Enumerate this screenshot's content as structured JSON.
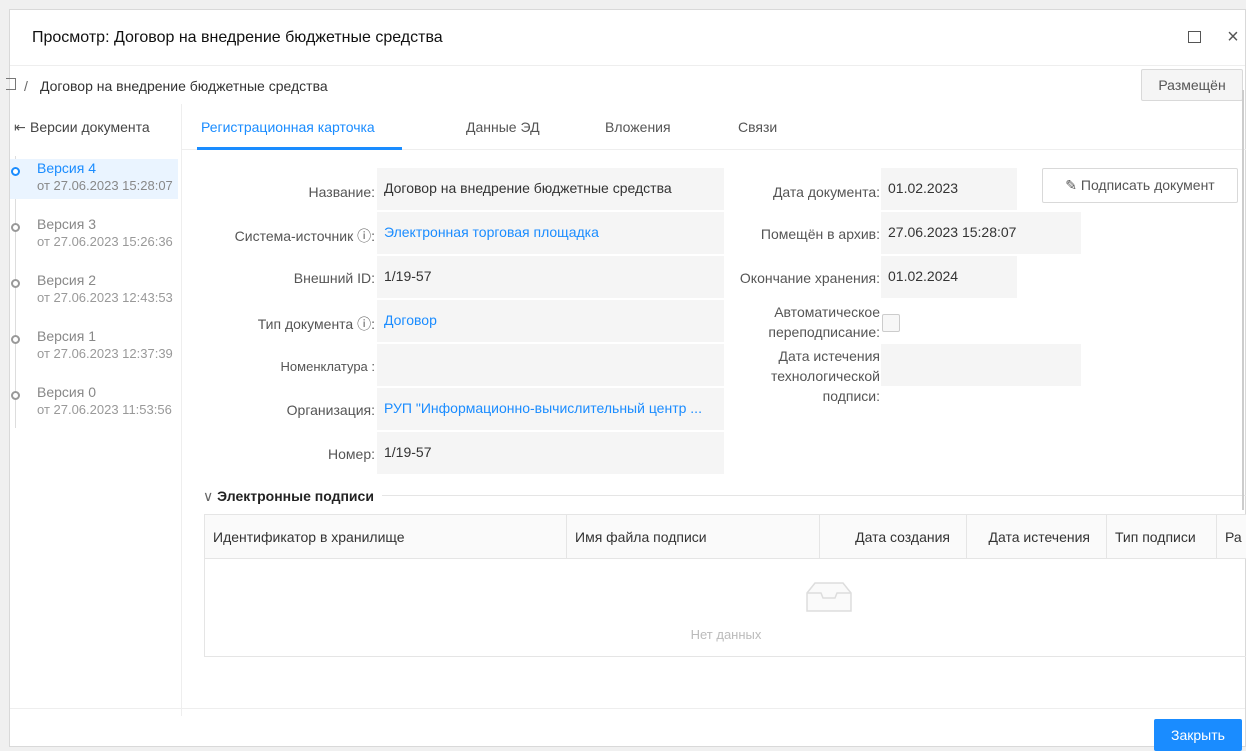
{
  "window": {
    "title": "Просмотр: Договор на внедрение бюджетные средства",
    "maximize_icon": "maximize-icon",
    "close_symbol": "×"
  },
  "breadcrumb": {
    "separator": "/",
    "text": "Договор на внедрение бюджетные средства",
    "status": "Размещён"
  },
  "sidebar": {
    "header": "Версии документа",
    "versions": [
      {
        "title": "Версия 4",
        "date": "от 27.06.2023 15:28:07",
        "active": true
      },
      {
        "title": "Версия 3",
        "date": "от 27.06.2023 15:26:36",
        "active": false
      },
      {
        "title": "Версия 2",
        "date": "от 27.06.2023 12:43:53",
        "active": false
      },
      {
        "title": "Версия 1",
        "date": "от 27.06.2023 12:37:39",
        "active": false
      },
      {
        "title": "Версия 0",
        "date": "от 27.06.2023 11:53:56",
        "active": false
      }
    ]
  },
  "tabs": [
    {
      "label": "Регистрационная карточка",
      "active": true
    },
    {
      "label": "Данные ЭД",
      "active": false
    },
    {
      "label": "Вложения",
      "active": false
    },
    {
      "label": "Связи",
      "active": false
    }
  ],
  "fields_left": {
    "name_label": "Название:",
    "name_value": "Договор на внедрение  бюджетные средства",
    "source_label": "Система-источник ⓘ:",
    "source_value": "Электронная торговая площадка",
    "ext_id_label": "Внешний ID:",
    "ext_id_value": "1/19-57",
    "doc_type_label": "Тип документа ⓘ:",
    "doc_type_value": "Договор",
    "nomenclature_label": "Номенклатура :",
    "nomenclature_value": "",
    "org_label": "Организация:",
    "org_value": "РУП \"Информационно-вычислительный центр ...",
    "number_label": "Номер:",
    "number_value": "1/19-57"
  },
  "fields_right": {
    "doc_date_label": "Дата документа:",
    "doc_date_value": "01.02.2023",
    "archived_label": "Помещён в архив:",
    "archived_value": "27.06.2023 15:28:07",
    "storage_end_label": "Окончание хранения:",
    "storage_end_value": "01.02.2024",
    "auto_resign_label_1": "Автоматическое",
    "auto_resign_label_2": "переподписание:",
    "auto_resign_checked": false,
    "tech_sig_label_1": "Дата истечения",
    "tech_sig_label_2": "технологической",
    "tech_sig_label_3": "подписи:",
    "tech_sig_value": ""
  },
  "sign_button": "Подписать документ",
  "signatures": {
    "section_title": "Электронные подписи",
    "columns": [
      "Идентификатор в хранилище",
      "Имя файла подписи",
      "Дата создания",
      "Дата истечения",
      "Тип подписи",
      "Ра"
    ],
    "empty_text": "Нет данных"
  },
  "footer": {
    "close_label": "Закрыть"
  },
  "colors": {
    "accent": "#1a8cff",
    "field_bg": "#f5f5f5"
  }
}
